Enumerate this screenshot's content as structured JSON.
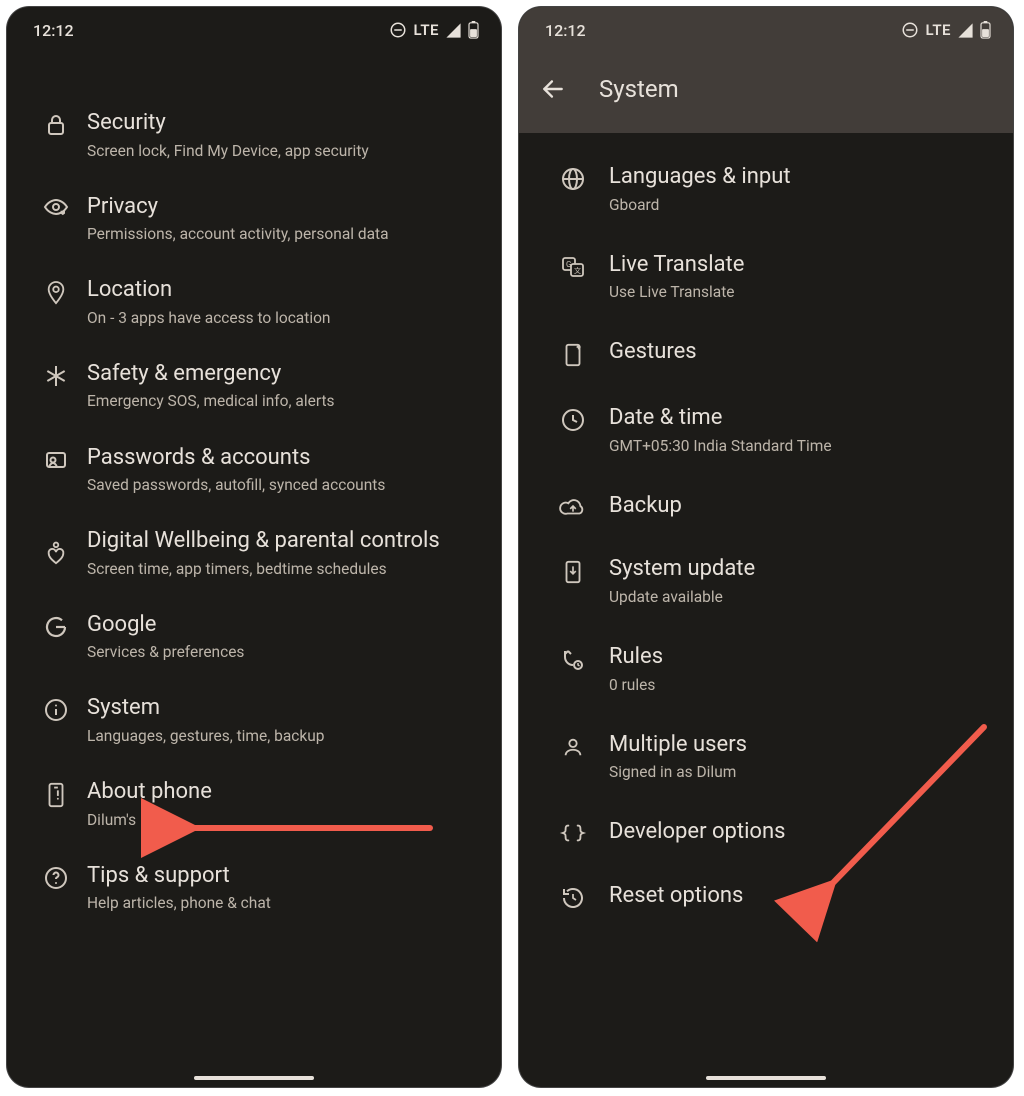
{
  "status": {
    "time": "12:12",
    "network_label": "LTE"
  },
  "left": {
    "items": [
      {
        "icon": "lock-icon",
        "title": "Security",
        "sub": "Screen lock, Find My Device, app security"
      },
      {
        "icon": "eye-shield-icon",
        "title": "Privacy",
        "sub": "Permissions, account activity, personal data"
      },
      {
        "icon": "pin-icon",
        "title": "Location",
        "sub": "On - 3 apps have access to location"
      },
      {
        "icon": "asterisk-icon",
        "title": "Safety & emergency",
        "sub": "Emergency SOS, medical info, alerts"
      },
      {
        "icon": "key-account-icon",
        "title": "Passwords & accounts",
        "sub": "Saved passwords, autofill, synced accounts"
      },
      {
        "icon": "heart-person-icon",
        "title": "Digital Wellbeing & parental controls",
        "sub": "Screen time, app timers, bedtime schedules"
      },
      {
        "icon": "google-icon",
        "title": "Google",
        "sub": "Services & preferences"
      },
      {
        "icon": "info-icon",
        "title": "System",
        "sub": "Languages, gestures, time, backup"
      },
      {
        "icon": "device-icon",
        "title": "About phone",
        "sub": "Dilum's Pixel"
      },
      {
        "icon": "help-icon",
        "title": "Tips & support",
        "sub": "Help articles, phone & chat"
      }
    ]
  },
  "right": {
    "app_title": "System",
    "items": [
      {
        "icon": "globe-icon",
        "title": "Languages & input",
        "sub": "Gboard"
      },
      {
        "icon": "translate-icon",
        "title": "Live Translate",
        "sub": "Use Live Translate"
      },
      {
        "icon": "phone-gesture-icon",
        "title": "Gestures",
        "sub": ""
      },
      {
        "icon": "clock-icon",
        "title": "Date & time",
        "sub": "GMT+05:30 India Standard Time"
      },
      {
        "icon": "cloud-up-icon",
        "title": "Backup",
        "sub": ""
      },
      {
        "icon": "download-device-icon",
        "title": "System update",
        "sub": "Update available"
      },
      {
        "icon": "rules-icon",
        "title": "Rules",
        "sub": "0 rules"
      },
      {
        "icon": "person-icon",
        "title": "Multiple users",
        "sub": "Signed in as Dilum"
      },
      {
        "icon": "braces-icon",
        "title": "Developer options",
        "sub": ""
      },
      {
        "icon": "restore-icon",
        "title": "Reset options",
        "sub": ""
      }
    ]
  },
  "annotation_color": "#f15c4c"
}
